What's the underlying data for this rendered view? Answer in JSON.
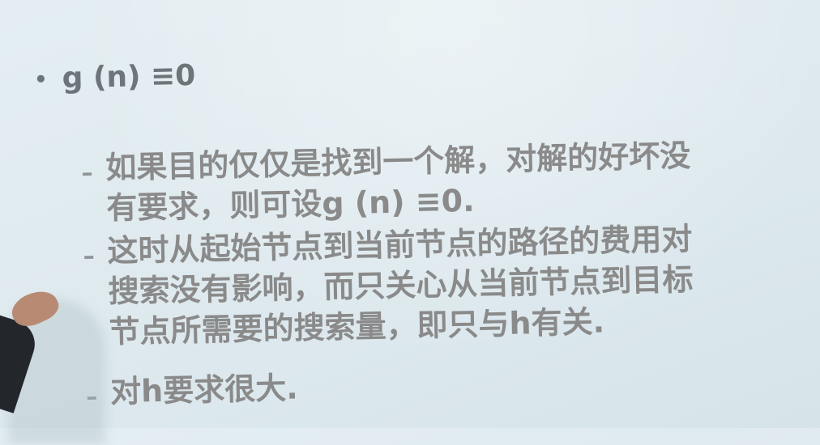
{
  "slide": {
    "bullet": "g (n) ≡0",
    "items": [
      {
        "dash": "–",
        "lines": [
          "如果目的仅仅是找到一个解，对解的好坏没",
          "有要求，则可设g (n) ≡0."
        ]
      },
      {
        "dash": "–",
        "lines": [
          "这时从起始节点到当前节点的路径的费用对",
          "搜索没有影响，而只关心从当前节点到目标",
          "节点所需要的搜索量，即只与h有关."
        ]
      },
      {
        "dash": "–",
        "lines": [
          "对h要求很大."
        ]
      }
    ]
  }
}
